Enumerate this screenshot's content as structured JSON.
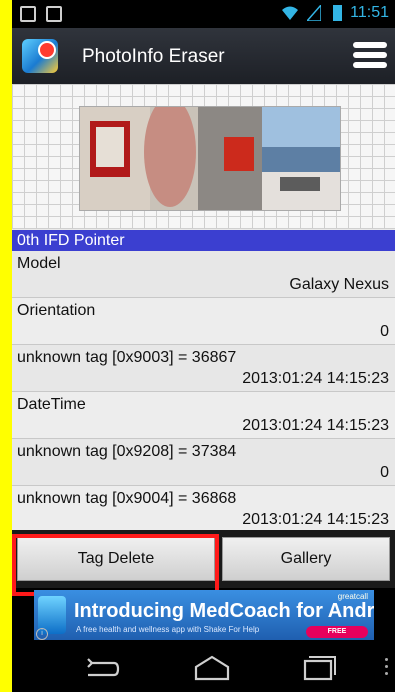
{
  "status": {
    "time": "11:51"
  },
  "app": {
    "title": "PhotoInfo Eraser"
  },
  "section": {
    "title": "0th IFD Pointer"
  },
  "rows": [
    {
      "label": "Model",
      "value": "Galaxy Nexus"
    },
    {
      "label": "Orientation",
      "value": "0"
    },
    {
      "label": "unknown tag [0x9003] = 36867",
      "value": "2013:01:24 14:15:23"
    },
    {
      "label": "DateTime",
      "value": "2013:01:24 14:15:23"
    },
    {
      "label": "unknown tag [0x9208] = 37384",
      "value": "0"
    },
    {
      "label": "unknown tag [0x9004] = 36868",
      "value": "2013:01:24 14:15:23"
    }
  ],
  "buttons": {
    "tag_delete": "Tag Delete",
    "gallery": "Gallery"
  },
  "ad": {
    "title": "Introducing MedCoach for Android",
    "subtitle": "A free health and wellness app with Shake For Help",
    "brand": "greatcall",
    "cta": "FREE DOWNLOAD"
  },
  "colors": {
    "highlight": "#ff1a1a",
    "section_header": "#3b3fd0",
    "background": "#ffff00"
  }
}
